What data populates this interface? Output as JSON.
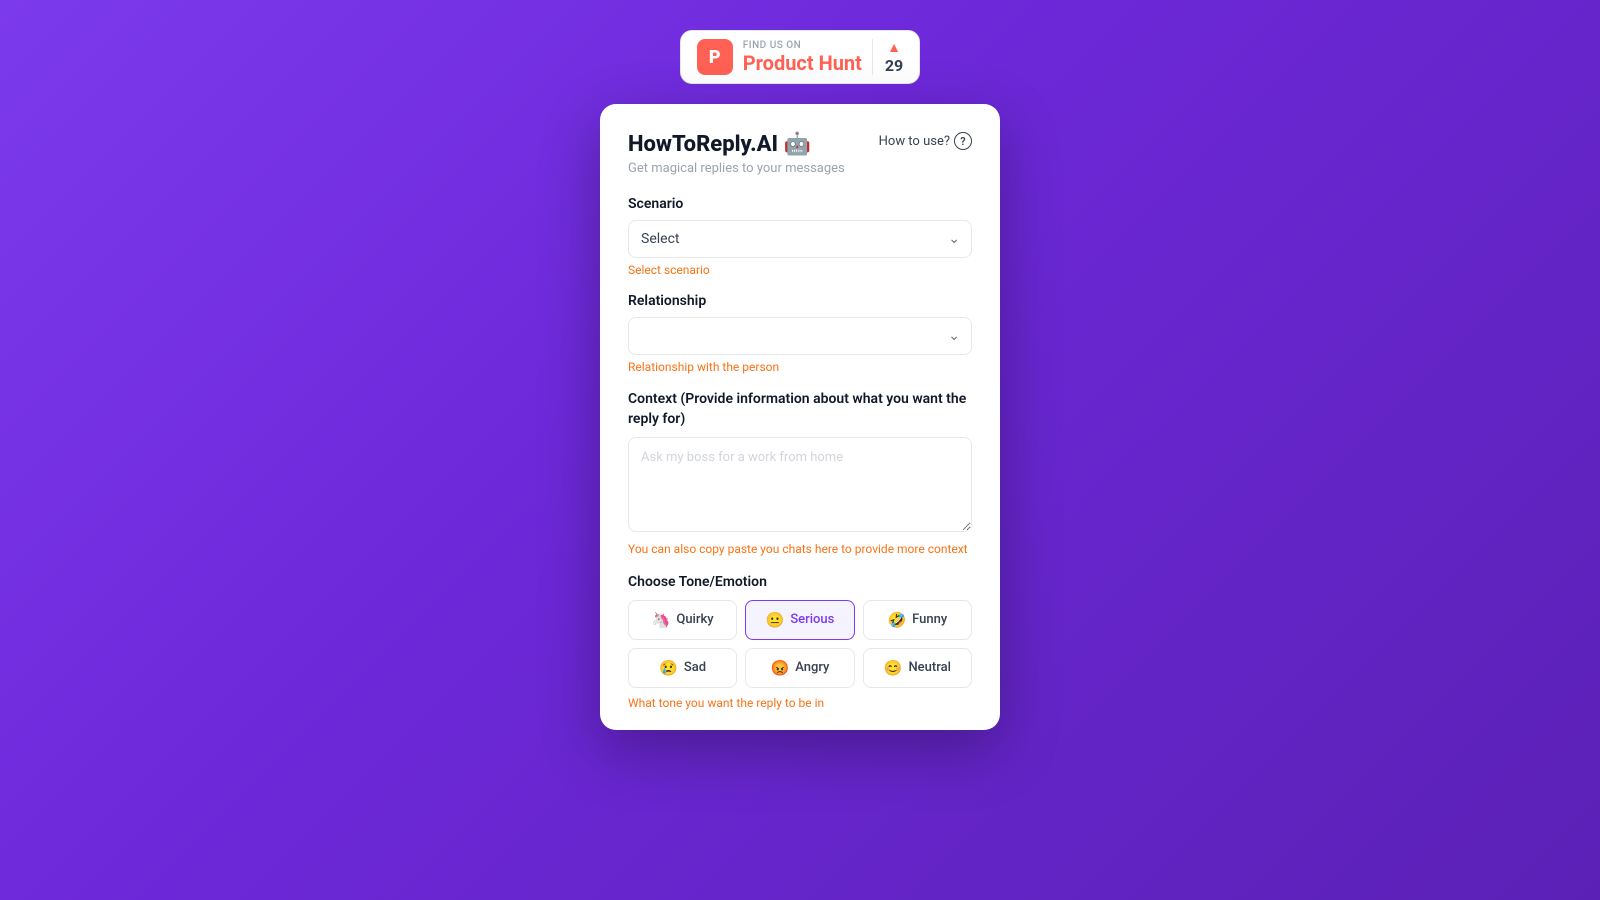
{
  "product_hunt": {
    "find_us_label": "FIND US ON",
    "name": "Product Hunt",
    "logo_letter": "P",
    "count": "29",
    "arrow": "▲"
  },
  "app": {
    "title": "HowToReply.AI 🤖",
    "subtitle": "Get magical replies to your messages",
    "how_to_use_label": "How to use?",
    "scenario": {
      "label": "Scenario",
      "placeholder": "Select",
      "hint": "Select scenario"
    },
    "relationship": {
      "label": "Relationship",
      "placeholder": "",
      "hint": "Relationship with the person"
    },
    "context": {
      "label": "Context (Provide information about what you want the reply for)",
      "placeholder": "Ask my boss for a work from home",
      "hint": "You can also copy paste you chats here to provide more context"
    },
    "tone": {
      "label": "Choose Tone/Emotion",
      "hint": "What tone you want the reply to be in",
      "options": [
        {
          "id": "quirky",
          "emoji": "🦄",
          "label": "Quirky"
        },
        {
          "id": "serious",
          "emoji": "😐",
          "label": "Serious"
        },
        {
          "id": "funny",
          "emoji": "🤣",
          "label": "Funny"
        },
        {
          "id": "sad",
          "emoji": "😢",
          "label": "Sad"
        },
        {
          "id": "angry",
          "emoji": "😡",
          "label": "Angry"
        },
        {
          "id": "neutral",
          "emoji": "😊",
          "label": "Neutral"
        }
      ]
    }
  }
}
